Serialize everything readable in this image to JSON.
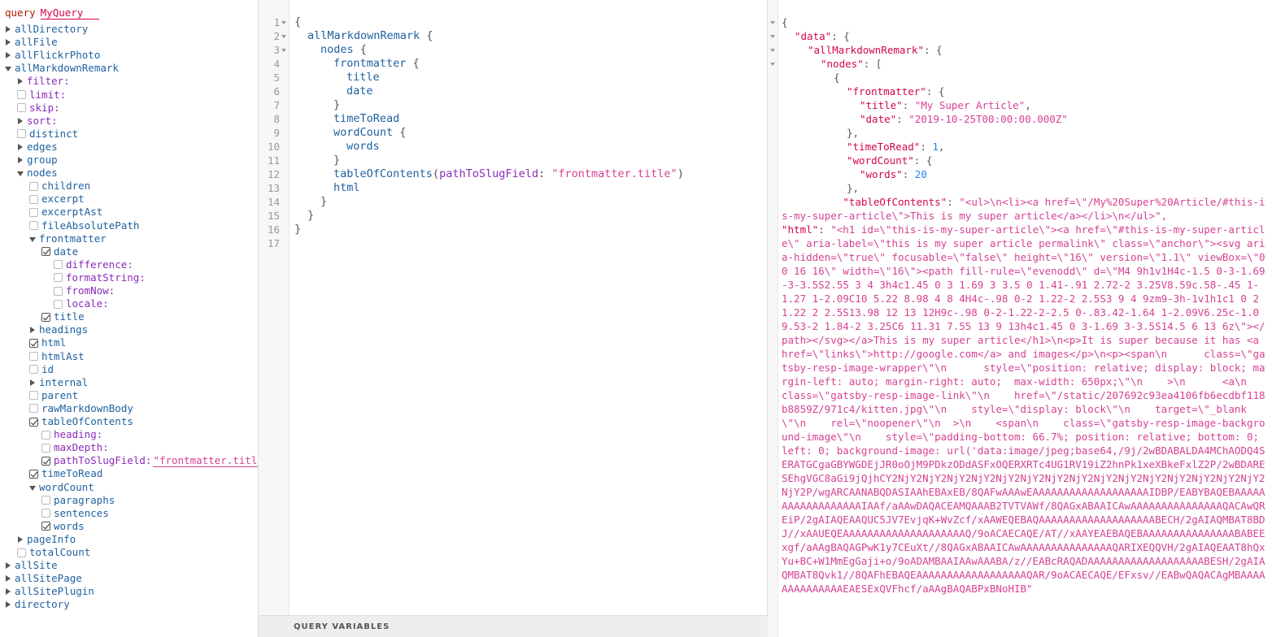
{
  "explorer": {
    "query_keyword": "query",
    "query_name": "MyQuery",
    "rows": [
      {
        "d": 0,
        "t": "a",
        "open": false,
        "label": "allDirectory",
        "k": "f"
      },
      {
        "d": 0,
        "t": "a",
        "open": false,
        "label": "allFile",
        "k": "f"
      },
      {
        "d": 0,
        "t": "a",
        "open": false,
        "label": "allFlickrPhoto",
        "k": "f"
      },
      {
        "d": 0,
        "t": "a",
        "open": true,
        "label": "allMarkdownRemark",
        "k": "f"
      },
      {
        "d": 1,
        "t": "a",
        "open": false,
        "label": "filter:",
        "k": "a"
      },
      {
        "d": 1,
        "t": "c",
        "on": false,
        "label": "limit:",
        "k": "a"
      },
      {
        "d": 1,
        "t": "c",
        "on": false,
        "label": "skip:",
        "k": "a"
      },
      {
        "d": 1,
        "t": "a",
        "open": false,
        "label": "sort:",
        "k": "a"
      },
      {
        "d": 1,
        "t": "c",
        "on": false,
        "label": "distinct",
        "k": "f"
      },
      {
        "d": 1,
        "t": "a",
        "open": false,
        "label": "edges",
        "k": "f"
      },
      {
        "d": 1,
        "t": "a",
        "open": false,
        "label": "group",
        "k": "f"
      },
      {
        "d": 1,
        "t": "a",
        "open": true,
        "label": "nodes",
        "k": "f"
      },
      {
        "d": 2,
        "t": "c",
        "on": false,
        "label": "children",
        "k": "f"
      },
      {
        "d": 2,
        "t": "c",
        "on": false,
        "label": "excerpt",
        "k": "f"
      },
      {
        "d": 2,
        "t": "c",
        "on": false,
        "label": "excerptAst",
        "k": "f"
      },
      {
        "d": 2,
        "t": "c",
        "on": false,
        "label": "fileAbsolutePath",
        "k": "f"
      },
      {
        "d": 2,
        "t": "a",
        "open": true,
        "label": "frontmatter",
        "k": "f"
      },
      {
        "d": 3,
        "t": "c",
        "on": true,
        "label": "date",
        "k": "f"
      },
      {
        "d": 4,
        "t": "c",
        "on": false,
        "label": "difference:",
        "k": "a"
      },
      {
        "d": 4,
        "t": "c",
        "on": false,
        "label": "formatString:",
        "k": "a"
      },
      {
        "d": 4,
        "t": "c",
        "on": false,
        "label": "fromNow:",
        "k": "a"
      },
      {
        "d": 4,
        "t": "c",
        "on": false,
        "label": "locale:",
        "k": "a"
      },
      {
        "d": 3,
        "t": "c",
        "on": true,
        "label": "title",
        "k": "f"
      },
      {
        "d": 2,
        "t": "a",
        "open": false,
        "label": "headings",
        "k": "f"
      },
      {
        "d": 2,
        "t": "c",
        "on": true,
        "label": "html",
        "k": "f"
      },
      {
        "d": 2,
        "t": "c",
        "on": false,
        "label": "htmlAst",
        "k": "f"
      },
      {
        "d": 2,
        "t": "c",
        "on": false,
        "label": "id",
        "k": "f"
      },
      {
        "d": 2,
        "t": "a",
        "open": false,
        "label": "internal",
        "k": "f"
      },
      {
        "d": 2,
        "t": "c",
        "on": false,
        "label": "parent",
        "k": "f"
      },
      {
        "d": 2,
        "t": "c",
        "on": false,
        "label": "rawMarkdownBody",
        "k": "f"
      },
      {
        "d": 2,
        "t": "c",
        "on": true,
        "label": "tableOfContents",
        "k": "f"
      },
      {
        "d": 3,
        "t": "c",
        "on": false,
        "label": "heading:",
        "k": "a"
      },
      {
        "d": 3,
        "t": "c",
        "on": false,
        "label": "maxDepth:",
        "k": "a"
      },
      {
        "d": 3,
        "t": "c",
        "on": true,
        "label": "pathToSlugField:",
        "k": "a",
        "value": "\"frontmatter.title"
      },
      {
        "d": 2,
        "t": "c",
        "on": true,
        "label": "timeToRead",
        "k": "f"
      },
      {
        "d": 2,
        "t": "a",
        "open": true,
        "label": "wordCount",
        "k": "f"
      },
      {
        "d": 3,
        "t": "c",
        "on": false,
        "label": "paragraphs",
        "k": "f"
      },
      {
        "d": 3,
        "t": "c",
        "on": false,
        "label": "sentences",
        "k": "f"
      },
      {
        "d": 3,
        "t": "c",
        "on": true,
        "label": "words",
        "k": "f"
      },
      {
        "d": 1,
        "t": "a",
        "open": false,
        "label": "pageInfo",
        "k": "f"
      },
      {
        "d": 1,
        "t": "c",
        "on": false,
        "label": "totalCount",
        "k": "f"
      },
      {
        "d": 0,
        "t": "a",
        "open": false,
        "label": "allSite",
        "k": "f"
      },
      {
        "d": 0,
        "t": "a",
        "open": false,
        "label": "allSitePage",
        "k": "f"
      },
      {
        "d": 0,
        "t": "a",
        "open": false,
        "label": "allSitePlugin",
        "k": "f"
      },
      {
        "d": 0,
        "t": "a",
        "open": false,
        "label": "directory",
        "k": "f"
      }
    ]
  },
  "editor": {
    "lines": [
      {
        "n": "1",
        "fold": true,
        "ind": 0,
        "toks": [
          [
            "p",
            "{"
          ]
        ]
      },
      {
        "n": "2",
        "fold": true,
        "ind": 1,
        "toks": [
          [
            "f",
            "allMarkdownRemark"
          ],
          [
            "p",
            " {"
          ]
        ]
      },
      {
        "n": "3",
        "fold": true,
        "ind": 2,
        "toks": [
          [
            "f",
            "nodes"
          ],
          [
            "p",
            " {"
          ]
        ]
      },
      {
        "n": "4",
        "fold": false,
        "ind": 3,
        "toks": [
          [
            "f",
            "frontmatter"
          ],
          [
            "p",
            " {"
          ]
        ]
      },
      {
        "n": "5",
        "fold": false,
        "ind": 4,
        "toks": [
          [
            "f",
            "title"
          ]
        ]
      },
      {
        "n": "6",
        "fold": false,
        "ind": 4,
        "toks": [
          [
            "f",
            "date"
          ]
        ]
      },
      {
        "n": "7",
        "fold": false,
        "ind": 3,
        "toks": [
          [
            "p",
            "}"
          ]
        ]
      },
      {
        "n": "8",
        "fold": false,
        "ind": 3,
        "toks": [
          [
            "f",
            "timeToRead"
          ]
        ]
      },
      {
        "n": "9",
        "fold": false,
        "ind": 3,
        "toks": [
          [
            "f",
            "wordCount"
          ],
          [
            "p",
            " {"
          ]
        ]
      },
      {
        "n": "10",
        "fold": false,
        "ind": 4,
        "toks": [
          [
            "f",
            "words"
          ]
        ]
      },
      {
        "n": "11",
        "fold": false,
        "ind": 3,
        "toks": [
          [
            "p",
            "}"
          ]
        ]
      },
      {
        "n": "12",
        "fold": false,
        "ind": 3,
        "toks": [
          [
            "f",
            "tableOfContents"
          ],
          [
            "p",
            "("
          ],
          [
            "a",
            "pathToSlugField"
          ],
          [
            "p",
            ": "
          ],
          [
            "s",
            "\"frontmatter.title\""
          ],
          [
            "p",
            ")"
          ]
        ]
      },
      {
        "n": "13",
        "fold": false,
        "ind": 3,
        "toks": [
          [
            "f",
            "html"
          ]
        ]
      },
      {
        "n": "14",
        "fold": false,
        "ind": 2,
        "toks": [
          [
            "p",
            "}"
          ]
        ]
      },
      {
        "n": "15",
        "fold": false,
        "ind": 1,
        "toks": [
          [
            "p",
            "}"
          ]
        ]
      },
      {
        "n": "16",
        "fold": false,
        "ind": 0,
        "toks": [
          [
            "p",
            "}"
          ]
        ]
      },
      {
        "n": "17",
        "fold": false,
        "ind": 0,
        "toks": []
      }
    ],
    "query_variables_label": "QUERY VARIABLES"
  },
  "result": {
    "lines": [
      {
        "fold": true,
        "ind": 0,
        "toks": [
          [
            "p",
            "{"
          ]
        ]
      },
      {
        "fold": true,
        "ind": 1,
        "toks": [
          [
            "k",
            "\"data\""
          ],
          [
            "p",
            ": {"
          ]
        ]
      },
      {
        "fold": true,
        "ind": 2,
        "toks": [
          [
            "k",
            "\"allMarkdownRemark\""
          ],
          [
            "p",
            ": {"
          ]
        ]
      },
      {
        "fold": true,
        "ind": 3,
        "toks": [
          [
            "k",
            "\"nodes\""
          ],
          [
            "p",
            ": ["
          ]
        ]
      },
      {
        "fold": false,
        "ind": 4,
        "toks": [
          [
            "p",
            "{"
          ]
        ]
      },
      {
        "fold": false,
        "ind": 5,
        "toks": [
          [
            "k",
            "\"frontmatter\""
          ],
          [
            "p",
            ": {"
          ]
        ]
      },
      {
        "fold": false,
        "ind": 6,
        "toks": [
          [
            "k",
            "\"title\""
          ],
          [
            "p",
            ": "
          ],
          [
            "s",
            "\"My Super Article\""
          ],
          [
            "p",
            ","
          ]
        ]
      },
      {
        "fold": false,
        "ind": 6,
        "toks": [
          [
            "k",
            "\"date\""
          ],
          [
            "p",
            ": "
          ],
          [
            "s",
            "\"2019-10-25T00:00:00.000Z\""
          ]
        ]
      },
      {
        "fold": false,
        "ind": 5,
        "toks": [
          [
            "p",
            "},"
          ]
        ]
      },
      {
        "fold": false,
        "ind": 5,
        "toks": [
          [
            "k",
            "\"timeToRead\""
          ],
          [
            "p",
            ": "
          ],
          [
            "n",
            "1"
          ],
          [
            "p",
            ","
          ]
        ]
      },
      {
        "fold": false,
        "ind": 5,
        "toks": [
          [
            "k",
            "\"wordCount\""
          ],
          [
            "p",
            ": {"
          ]
        ]
      },
      {
        "fold": false,
        "ind": 6,
        "toks": [
          [
            "k",
            "\"words\""
          ],
          [
            "p",
            ": "
          ],
          [
            "n",
            "20"
          ]
        ]
      },
      {
        "fold": false,
        "ind": 5,
        "toks": [
          [
            "p",
            "},"
          ]
        ]
      }
    ],
    "toc_key": "\"tableOfContents\"",
    "toc_value": "\"<ul>\\n<li><a href=\\\"/My%20Super%20Article/#this-is-my-super-article\\\">This is my super article</a></li>\\n</ul>\",",
    "html_key": "\"html\"",
    "html_value": "\"<h1 id=\\\"this-is-my-super-article\\\"><a href=\\\"#this-is-my-super-article\\\" aria-label=\\\"this is my super article permalink\\\" class=\\\"anchor\\\"><svg aria-hidden=\\\"true\\\" focusable=\\\"false\\\" height=\\\"16\\\" version=\\\"1.1\\\" viewBox=\\\"0 0 16 16\\\" width=\\\"16\\\"><path fill-rule=\\\"evenodd\\\" d=\\\"M4 9h1v1H4c-1.5 0-3-1.69-3-3.5S2.55 3 4 3h4c1.45 0 3 1.69 3 3.5 0 1.41-.91 2.72-2 3.25V8.59c.58-.45 1-1.27 1-2.09C10 5.22 8.98 4 8 4H4c-.98 0-2 1.22-2 2.5S3 9 4 9zm9-3h-1v1h1c1 0 2 1.22 2 2.5S13.98 12 13 12H9c-.98 0-2-1.22-2-2.5 0-.83.42-1.64 1-2.09V6.25c-1.09.53-2 1.84-2 3.25C6 11.31 7.55 13 9 13h4c1.45 0 3-1.69 3-3.5S14.5 6 13 6z\\\"></path></svg></a>This is my super article</h1>\\n<p>It is super because it has <a href=\\\"links\\\">http://google.com</a> and images</p>\\n<p><span\\n      class=\\\"gatsby-resp-image-wrapper\\\"\\n      style=\\\"position: relative; display: block; margin-left: auto; margin-right: auto;  max-width: 650px;\\\"\\n    >\\n      <a\\n    class=\\\"gatsby-resp-image-link\\\"\\n    href=\\\"/static/207692c93ea4106fb6ecdbf118b8859Z/971c4/kitten.jpg\\\"\\n    style=\\\"display: block\\\"\\n    target=\\\"_blank\\\"\\n    rel=\\\"noopener\\\"\\n  >\\n    <span\\n    class=\\\"gatsby-resp-image-background-image\\\"\\n    style=\\\"padding-bottom: 66.7%; position: relative; bottom: 0; left: 0; background-image: url('data:image/jpeg;base64,/9j/2wBDABALDA4MChAODQ4SERATGCgaGBYWGDEjJR0oOjM9PDkzODdASFxOQERXRTc4UG1RV19iZ2hnPk1xeXBkeFxlZ2P/2wBDARESEhgVGC8aGi9jQjhCY2NjY2NjY2NjY2NjY2NjY2NjY2NjY2NjY2NjY2NjY2NjY2NjY2NjY2NjY2NjY2NjY2P/wgARCAANABQDASIAAhEBAxEB/8QAFwAAAwEAAAAAAAAAAAAAAAAAAAIDBP/EABYBAQEBAAAAAAAAAAAAAAAAAAIAAf/aAAwDAQACEAMQAAAB2TVTVAWf/8QAGxABAAICAwAAAAAAAAAAAAAAAQACAwQREiP/2gAIAQEAAQUC5JV7EvjqK+WvZcf/xAAWEQEBAQAAAAAAAAAAAAAAAAAAABECH/2gAIAQMBAT8BDJ//xAAUEQEAAAAAAAAAAAAAAAAAAAAQ/9oACAECAQE/AT//xAAYEAEBAQEBAAAAAAAAAAAAAAABABEExgf/aAAgBAQAGPwK1y7CEuXt//8QAGxABAAICAwAAAAAAAAAAAAAAAQARIXEQQVH/2gAIAQEAAT8hQxYu+BC+W1MmEgGaji+o/9oADAMBAAIAAwAAABA/z//EABcRAQADAAAAAAAAAAAAAAAAAAABESH/2gAIAQMBAT8Qvk1//8QAFhEBAQEAAAAAAAAAAAAAAAAAAQAR/9oACAECAQE/EFxsv//EABwQAQACAgMBAAAAAAAAAAAAAAEAESExQVFhcf/aAAgBAQABPxBNoHIB\""
  }
}
